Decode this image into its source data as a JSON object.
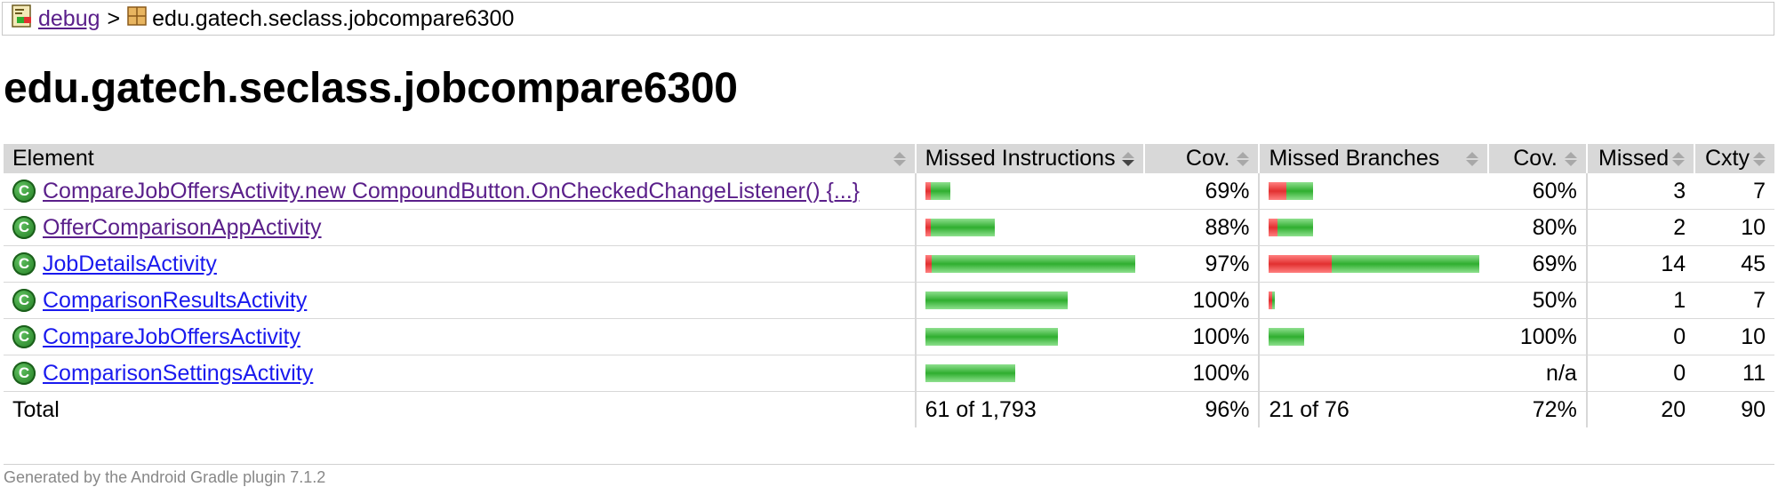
{
  "breadcrumb": {
    "root_label": "debug",
    "separator": ">",
    "current": "edu.gatech.seclass.jobcompare6300"
  },
  "page_title": "edu.gatech.seclass.jobcompare6300",
  "table": {
    "headers": {
      "element": "Element",
      "missed_instructions": "Missed Instructions",
      "cov1": "Cov.",
      "missed_branches": "Missed Branches",
      "cov2": "Cov.",
      "missed": "Missed",
      "cxty": "Cxty"
    },
    "rows": [
      {
        "name": "CompareJobOffersActivity.new CompoundButton.OnCheckedChangeListener() {...}",
        "visited": true,
        "instr_missed_fraction": 0.23,
        "instr_bar_scale": 0.12,
        "instr_cov": "69%",
        "br_missed_fraction": 0.4,
        "br_bar_scale": 0.21,
        "br_cov": "60%",
        "missed": "3",
        "cxty": "7"
      },
      {
        "name": "OfferComparisonAppActivity",
        "visited": true,
        "instr_missed_fraction": 0.08,
        "instr_bar_scale": 0.33,
        "instr_cov": "88%",
        "br_missed_fraction": 0.2,
        "br_bar_scale": 0.21,
        "br_cov": "80%",
        "missed": "2",
        "cxty": "10"
      },
      {
        "name": "JobDetailsActivity",
        "visited": false,
        "instr_missed_fraction": 0.03,
        "instr_bar_scale": 1.0,
        "instr_cov": "97%",
        "br_missed_fraction": 0.3,
        "br_bar_scale": 1.0,
        "br_cov": "69%",
        "missed": "14",
        "cxty": "45"
      },
      {
        "name": "ComparisonResultsActivity",
        "visited": false,
        "instr_missed_fraction": 0,
        "instr_bar_scale": 0.68,
        "instr_cov": "100%",
        "br_missed_fraction": 0.5,
        "br_bar_scale": 0.03,
        "br_cov": "50%",
        "missed": "1",
        "cxty": "7"
      },
      {
        "name": "CompareJobOffersActivity",
        "visited": false,
        "instr_missed_fraction": 0,
        "instr_bar_scale": 0.63,
        "instr_cov": "100%",
        "br_missed_fraction": 0,
        "br_bar_scale": 0.17,
        "br_cov": "100%",
        "missed": "0",
        "cxty": "10"
      },
      {
        "name": "ComparisonSettingsActivity",
        "visited": false,
        "instr_missed_fraction": 0,
        "instr_bar_scale": 0.43,
        "instr_cov": "100%",
        "br_missed_fraction": 0,
        "br_bar_scale": 0,
        "br_cov": "n/a",
        "missed": "0",
        "cxty": "11"
      }
    ],
    "total": {
      "label": "Total",
      "instr": "61 of 1,793",
      "instr_cov": "96%",
      "br": "21 of 76",
      "br_cov": "72%",
      "missed": "20",
      "cxty": "90"
    }
  },
  "footer": "Generated by the Android Gradle plugin 7.1.2",
  "colors": {
    "bar_red": "#e23030",
    "bar_green": "#2fae2f",
    "header_bg": "#d8d8d8",
    "link_visited": "#5a1f8a",
    "link": "#1a1aee"
  }
}
